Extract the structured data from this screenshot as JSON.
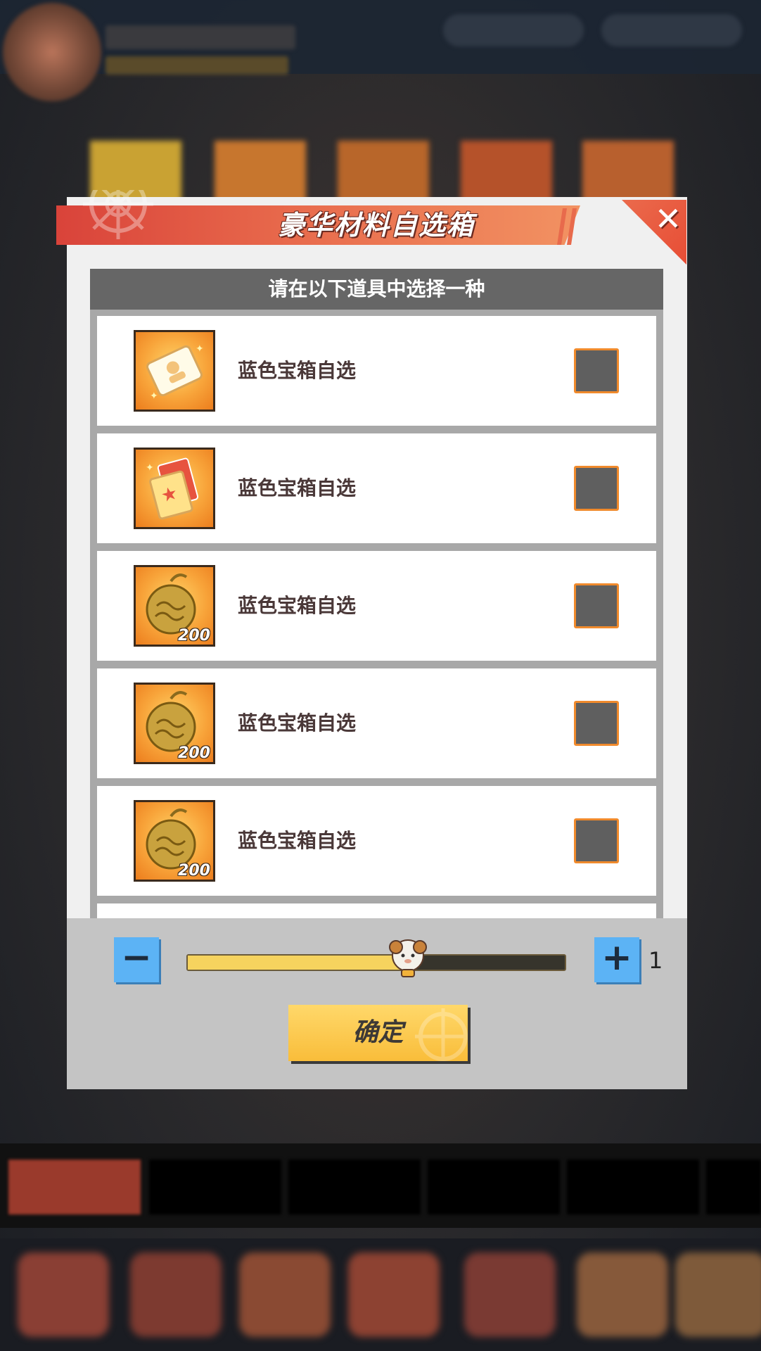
{
  "dialog": {
    "title": "豪华材料自选箱",
    "subtitle": "请在以下道具中选择一种",
    "close_icon": "close-icon"
  },
  "items": [
    {
      "label": "蓝色宝箱自选",
      "icon": "ticket-icon",
      "qty": ""
    },
    {
      "label": "蓝色宝箱自选",
      "icon": "card-pack-icon",
      "qty": ""
    },
    {
      "label": "蓝色宝箱自选",
      "icon": "devil-fruit-icon",
      "qty": "200"
    },
    {
      "label": "蓝色宝箱自选",
      "icon": "devil-fruit-icon",
      "qty": "200"
    },
    {
      "label": "蓝色宝箱自选",
      "icon": "devil-fruit-icon",
      "qty": "200"
    }
  ],
  "quantity": {
    "value": "1",
    "slider_fraction": 0.57,
    "minus_icon": "minus-icon",
    "plus_icon": "plus-icon"
  },
  "confirm": {
    "label": "确定"
  },
  "colors": {
    "ribbon": "#e8594a",
    "checkbox_border": "#f08a2c",
    "step_button": "#5cb3f5",
    "confirm_button": "#f9c24a"
  }
}
